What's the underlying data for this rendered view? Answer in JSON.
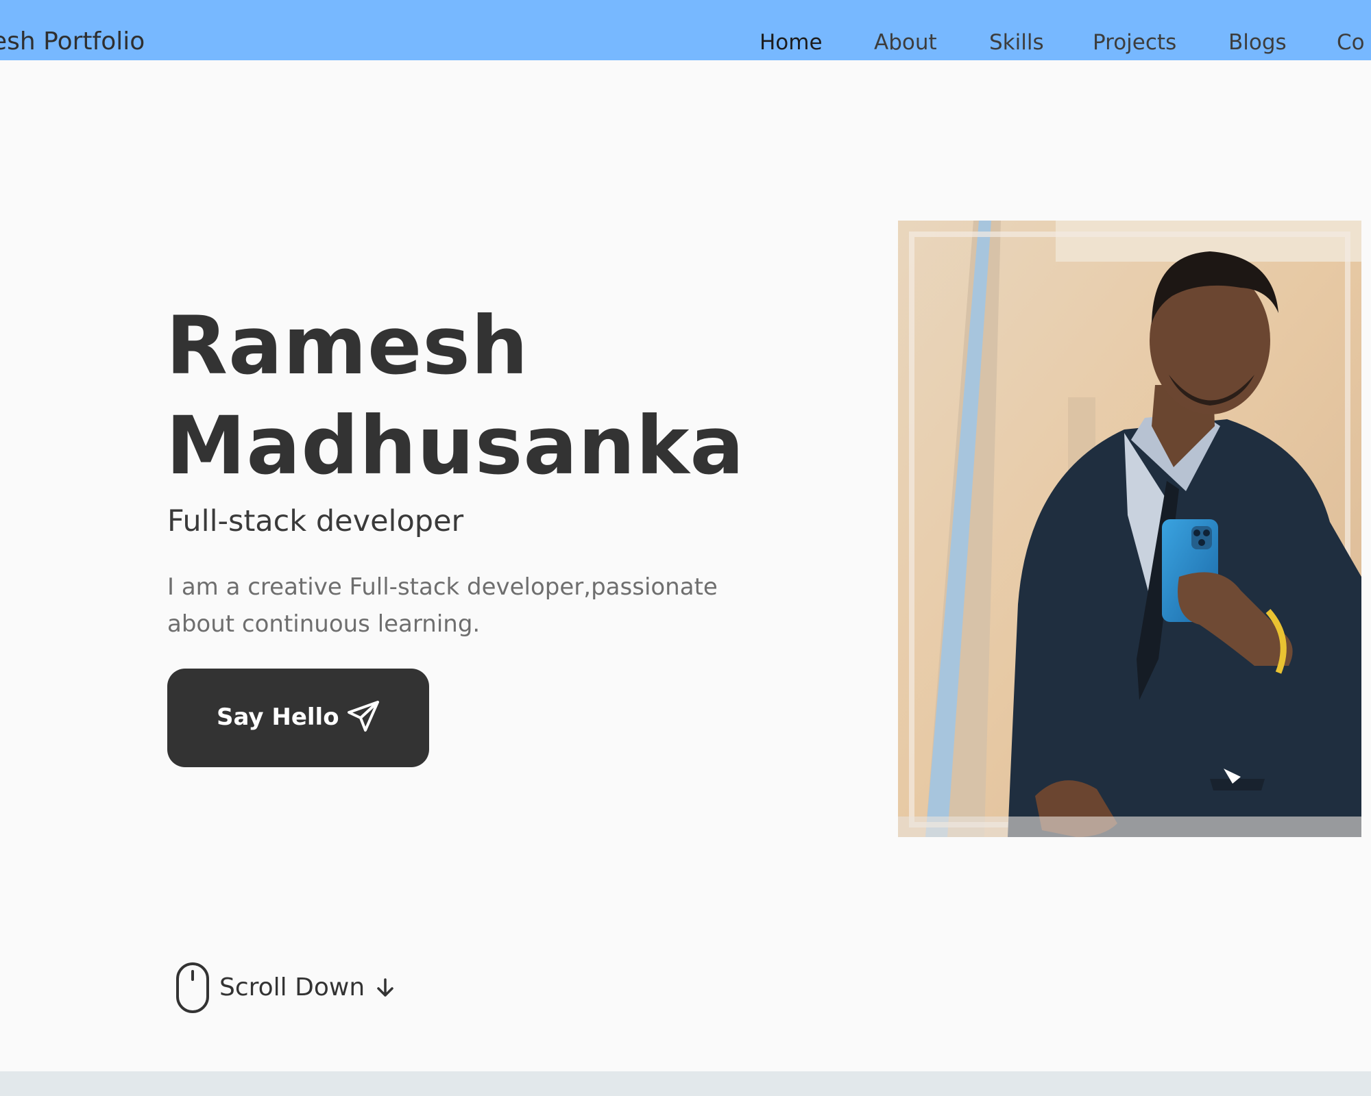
{
  "header": {
    "brand": "esh Portfolio",
    "nav": [
      {
        "label": "Home",
        "active": true
      },
      {
        "label": "About",
        "active": false
      },
      {
        "label": "Skills",
        "active": false
      },
      {
        "label": "Projects",
        "active": false
      },
      {
        "label": "Blogs",
        "active": false
      },
      {
        "label": "Co",
        "active": false
      }
    ]
  },
  "hero": {
    "name_line1": "Ramesh",
    "name_line2": "Madhusanka",
    "subtitle": "Full-stack developer",
    "description": "I am a creative Full-stack developer,passionate about continuous learning.",
    "cta_label": "Say Hello",
    "cta_icon": "send-icon",
    "photo_icon": "profile-photo"
  },
  "scroll": {
    "label": "Scroll Down",
    "icons": [
      "mouse-icon",
      "arrow-down-icon"
    ]
  },
  "colors": {
    "navbar_bg": "#77b8ff",
    "page_bg": "#fafafa",
    "text_dark": "#333333",
    "text_muted": "#6e6e6e",
    "button_bg": "#333333",
    "button_text": "#ffffff",
    "bottom_band": "#e2e8eb"
  }
}
